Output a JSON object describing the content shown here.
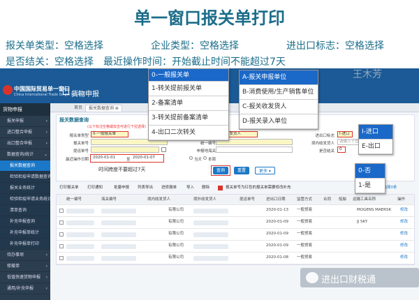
{
  "slide": {
    "title": "单一窗口报关单打印",
    "notes": {
      "declaration_type": "报关单类型：空格选择",
      "enterprise_type": "企业类型：空格选择",
      "ie_flag": "进出口标志：空格选择",
      "closed": "是否结关：空格选择",
      "recent_time": "最近操作时间：开始截止时间不能超过7天"
    }
  },
  "app": {
    "logo_cn": "中国国际贸易单一窗口",
    "logo_en": "China International Trade Single Window",
    "app_name": "货物申报",
    "user_name": "王木芳"
  },
  "sidebar": {
    "head": "货物申报",
    "items": [
      {
        "label": "报关申报",
        "arrow": "‹"
      },
      {
        "label": "进口整合申报",
        "arrow": "‹"
      },
      {
        "label": "出口整合申报",
        "arrow": "‹"
      },
      {
        "label": "数据查询/统计",
        "arrow": "⌄"
      },
      {
        "label": "报关数据查询"
      },
      {
        "label": "检验检疫申请数据查询"
      },
      {
        "label": "报关业务统计"
      },
      {
        "label": "检验检疫申请业务统计"
      },
      {
        "label": "清单查询"
      },
      {
        "label": "补充申报查询"
      },
      {
        "label": "补充申报单统计"
      },
      {
        "label": "补充申报单打印"
      },
      {
        "label": "待办事项",
        "arrow": "‹"
      },
      {
        "label": "修撤单",
        "arrow": "‹"
      },
      {
        "label": "低值快速货物申报",
        "arrow": "‹"
      },
      {
        "label": "通用/补充申报",
        "arrow": "‹"
      }
    ]
  },
  "tabs": {
    "home": "首页",
    "current": "报关数据查询 ⊗"
  },
  "panel": {
    "title": "报关数据查询",
    "hint": "(以下标注空格或双击可进行下拉选择)",
    "labels": {
      "decl_type": "报关单类型",
      "enterprise_type": "企业类型",
      "ie_flag": "进出口标志",
      "decl_no": "报关单号",
      "unified_no": "统一编号",
      "entry_exit_port": "境内收发货人",
      "bill_no": "提运单号",
      "customs_no": "申报地海关",
      "closed": "是否结关",
      "recent_time": "最近操作日期",
      "today": "当天",
      "week": "本周"
    },
    "values": {
      "decl_type": "0-一般报关单",
      "enterprise_type": "境内收发货人",
      "ie_flag": "I-进口",
      "date_from": "2020-01-01",
      "date_to": "2020-01-07",
      "date_sep": "至",
      "closed": "0",
      "unified_hint": "请输入十位编码，统一编号由18"
    },
    "time_note": "时间跨度不要超过7天",
    "query_btn": "查询",
    "reset_btn": "重置",
    "more_btn": "更多 ▾"
  },
  "toolbar": {
    "buttons": [
      "打印报关单",
      "打印通知",
      "批量申报",
      "列表导出",
      "进修撤单",
      "导入",
      "删除"
    ],
    "legend": "报关单号为红色的报关单需要修改补充",
    "selected_count": "已选择0条"
  },
  "grid": {
    "headers": [
      "统一编号",
      "海关编号",
      "境内收发货人",
      "境外收发货人",
      "提运单号",
      "进出口日期",
      "监管方式",
      "合同",
      "船舶",
      "运输工具名称",
      "操作"
    ],
    "rows": [
      {
        "consignee": "有限公司",
        "date": "2020-01-13",
        "mode": "一般贸易",
        "vessel": "MOGENS MAERSK",
        "op": "修改"
      },
      {
        "consignee": "有限公司",
        "date": "2020-01-09",
        "mode": "一般贸易",
        "vessel": "JJ SKY",
        "op": "修改"
      },
      {
        "consignee": "有限公司",
        "date": "2020-01-09",
        "mode": "一般贸易",
        "vessel": "",
        "op": "修改"
      },
      {
        "consignee": "有限公司",
        "date": "2020-01-09",
        "mode": "一般贸易",
        "vessel": "",
        "op": "修改"
      },
      {
        "consignee": "有限公司",
        "date": "2020-01-08",
        "mode": "一般贸易",
        "vessel": "",
        "op": "修改"
      }
    ]
  },
  "popups": {
    "decl_types": [
      "0-一般报关单",
      "1-转关提前报关单",
      "2-备案清单",
      "3-转关提前备案清单",
      "4-出口二次转关"
    ],
    "enterprise_types": [
      "A-报关申报单位",
      "B-消费使用/生产销售单位",
      "C-报关收发货人",
      "D-报关录入单位"
    ],
    "ie_flags": [
      "I-进口",
      "E-出口"
    ],
    "closed_options": [
      "0-否",
      "1-是"
    ]
  },
  "watermark": "进出口财税通",
  "colors": {
    "header_blue": "#1b5a96",
    "select_blue": "#1a68c8",
    "title_teal": "#1b6d8a",
    "highlight_red": "#d9342b"
  }
}
